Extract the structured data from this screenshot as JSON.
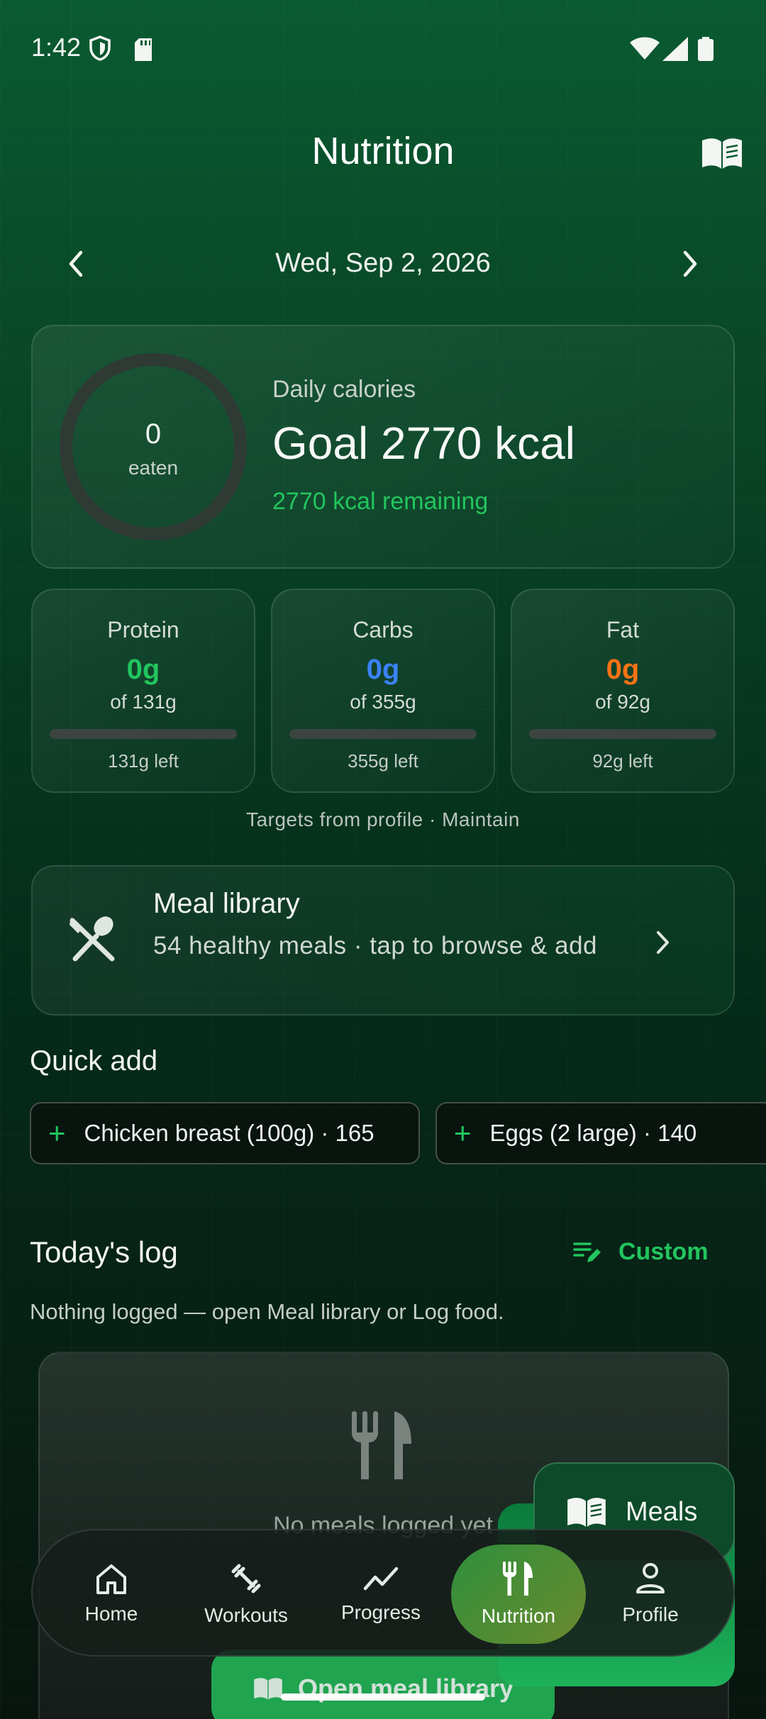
{
  "status_bar": {
    "time": "1:42"
  },
  "header": {
    "title": "Nutrition"
  },
  "date_nav": {
    "date": "Wed, Sep 2, 2026"
  },
  "calories": {
    "eaten": "0",
    "eaten_label": "eaten",
    "label": "Daily calories",
    "goal": "Goal 2770 kcal",
    "remaining": "2770 kcal remaining",
    "progress_fraction": 0
  },
  "macros": [
    {
      "name": "Protein",
      "value": "0g",
      "of": "of 131g",
      "left": "131g left",
      "color": "#22c55e",
      "progress_fraction": 0
    },
    {
      "name": "Carbs",
      "value": "0g",
      "of": "of 355g",
      "left": "355g left",
      "color": "#3b82f6",
      "progress_fraction": 0
    },
    {
      "name": "Fat",
      "value": "0g",
      "of": "of 92g",
      "left": "92g left",
      "color": "#f97316",
      "progress_fraction": 0
    }
  ],
  "targets_note": "Targets from profile · Maintain",
  "meal_library": {
    "title": "Meal library",
    "subtitle": "54 healthy meals · tap to browse & add"
  },
  "quick_add": {
    "title": "Quick add",
    "items": [
      {
        "label": "Chicken breast (100g) · 165"
      },
      {
        "label": "Eggs (2 large) · 140"
      }
    ]
  },
  "todays_log": {
    "title": "Today's log",
    "custom_label": "Custom",
    "empty_hint": "Nothing logged — open Meal library or Log food.",
    "empty_title": "No meals logged yet",
    "open_library_label": "Open meal library"
  },
  "fab": {
    "meals_label": "Meals"
  },
  "bottom_nav": {
    "items": [
      {
        "label": "Home",
        "icon": "home-icon"
      },
      {
        "label": "Workouts",
        "icon": "dumbbell-icon"
      },
      {
        "label": "Progress",
        "icon": "trend-icon"
      },
      {
        "label": "Nutrition",
        "icon": "utensils-icon",
        "active": true
      },
      {
        "label": "Profile",
        "icon": "person-icon"
      }
    ]
  },
  "colors": {
    "accent": "#22c55e",
    "protein": "#22c55e",
    "carbs": "#3b82f6",
    "fat": "#f97316",
    "nav_active": "#2f8f3c"
  }
}
